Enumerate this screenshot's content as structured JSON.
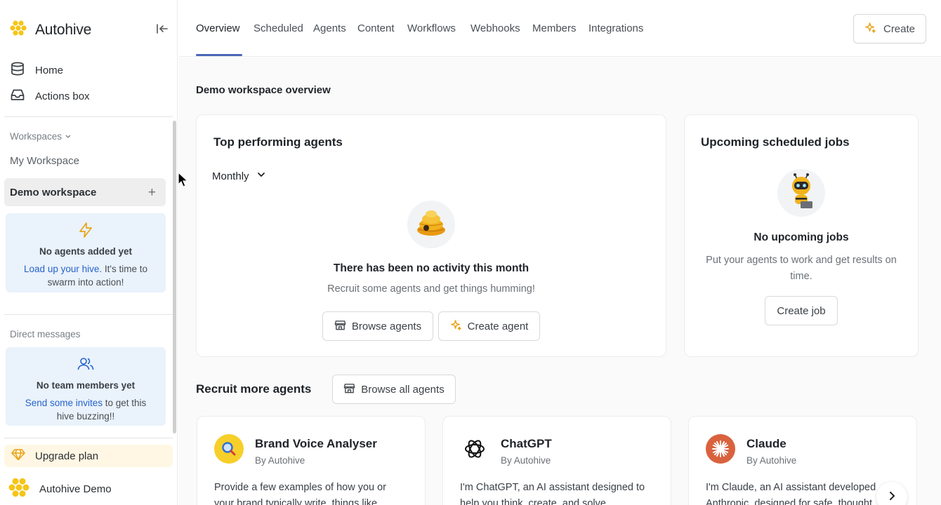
{
  "brand": {
    "name": "Autohive"
  },
  "sidebar": {
    "nav": [
      {
        "label": "Home",
        "icon": "database-icon"
      },
      {
        "label": "Actions box",
        "icon": "inbox-icon"
      }
    ],
    "workspaces_label": "Workspaces",
    "workspaces": [
      "My Workspace"
    ],
    "active_workspace": "Demo workspace",
    "agents_empty": {
      "title": "No agents added yet",
      "link": "Load up your hive.",
      "text": " It's time to swarm into action!"
    },
    "direct_messages_label": "Direct messages",
    "team_empty": {
      "title": "No team members yet",
      "link": "Send some invites",
      "text": " to get this hive buzzing!!"
    },
    "upgrade_label": "Upgrade plan",
    "user_name": "Autohive Demo"
  },
  "topbar": {
    "tabs": [
      "Overview",
      "Scheduled",
      "Agents",
      "Content",
      "Workflows",
      "Webhooks",
      "Members",
      "Integrations"
    ],
    "active_tab": "Overview",
    "create_label": "Create"
  },
  "main": {
    "title": "Demo workspace overview",
    "top_agents": {
      "title": "Top performing agents",
      "period": "Monthly",
      "empty_title": "There has been no activity this month",
      "empty_desc": "Recruit some agents and get things humming!",
      "browse_label": "Browse agents",
      "create_label": "Create agent"
    },
    "scheduled": {
      "title": "Upcoming scheduled jobs",
      "empty_title": "No upcoming jobs",
      "empty_desc_1": "Put your agents to work and get results on",
      "empty_desc_2": "time.",
      "create_job_label": "Create job"
    },
    "recruit": {
      "title": "Recruit more agents",
      "browse_all_label": "Browse all agents",
      "agents": [
        {
          "name": "Brand Voice Analyser",
          "by": "By Autohive",
          "line1": "Provide a few examples of how you or",
          "line2": "your brand typically write, things like"
        },
        {
          "name": "ChatGPT",
          "by": "By Autohive",
          "line1": "I'm ChatGPT, an AI assistant designed to",
          "line2": "help you think, create, and solve"
        },
        {
          "name": "Claude",
          "by": "By Autohive",
          "line1": "I'm Claude, an AI assistant developed",
          "line2": "Anthropic, designed for safe, thought"
        }
      ]
    }
  },
  "colors": {
    "accent": "#4a67b8",
    "link": "#2563c9",
    "honey": "#f4c21f",
    "upgrade_bg": "#fff7e3",
    "info_bg": "#eaf2fb"
  }
}
